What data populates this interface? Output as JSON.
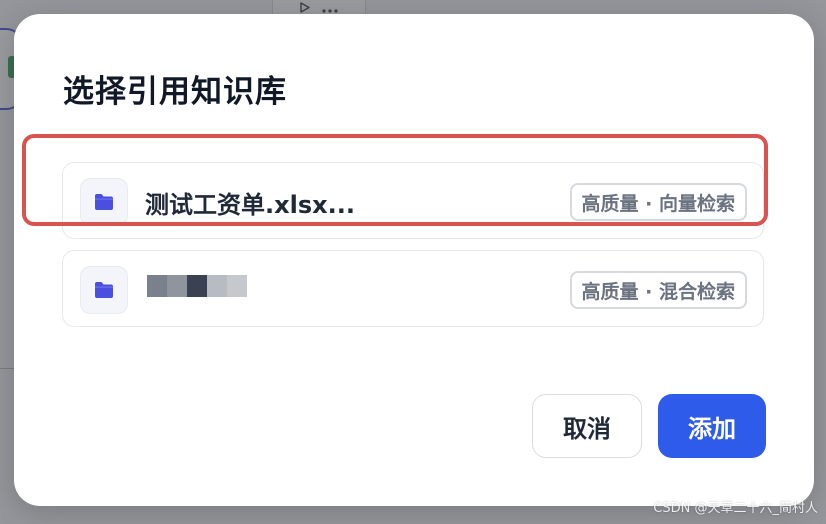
{
  "background": {
    "toolbar_icons": [
      "play-icon",
      "more-dots-icon"
    ]
  },
  "dialog": {
    "title": "选择引用知识库",
    "items": [
      {
        "name": "测试工资单.xlsx...",
        "tag": "高质量 · 向量检索",
        "icon": "folder-icon",
        "highlighted": true
      },
      {
        "name": "",
        "name_redacted": true,
        "tag": "高质量 · 混合检索",
        "icon": "folder-icon",
        "highlighted": false
      }
    ],
    "cancel_label": "取消",
    "add_label": "添加"
  },
  "colors": {
    "primary": "#2f5bea",
    "folder_icon": "#4a4fe0",
    "highlight_border": "#d9534f",
    "title_text": "#111827",
    "tag_text": "#6b7280"
  },
  "watermark": "CSDN @天草二十六_简村人"
}
